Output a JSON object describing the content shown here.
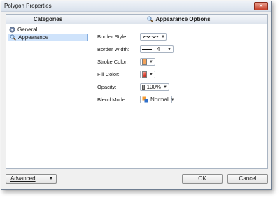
{
  "window": {
    "title": "Polygon Properties",
    "close_glyph": "✕"
  },
  "left_panel": {
    "header": "Categories",
    "items": [
      {
        "label": "General",
        "icon": "gear-icon",
        "selected": false
      },
      {
        "label": "Appearance",
        "icon": "magnifier-icon",
        "selected": true
      }
    ]
  },
  "right_panel": {
    "header": "Appearance Options",
    "header_icon": "magnifier-icon",
    "properties": {
      "border_style": {
        "label": "Border Style:",
        "icon": "curved-line-icon"
      },
      "border_width": {
        "label": "Border Width:",
        "value": "4"
      },
      "stroke_color": {
        "label": "Stroke Color:",
        "color": "#f3a25a"
      },
      "fill_color": {
        "label": "Fill Color:",
        "color": "#e34a3a"
      },
      "opacity": {
        "label": "Opacity:",
        "value": "100%"
      },
      "blend_mode": {
        "label": "Blend Mode:",
        "value": "Normal"
      }
    }
  },
  "buttons": {
    "advanced": "Advanced",
    "ok": "OK",
    "cancel": "Cancel"
  }
}
